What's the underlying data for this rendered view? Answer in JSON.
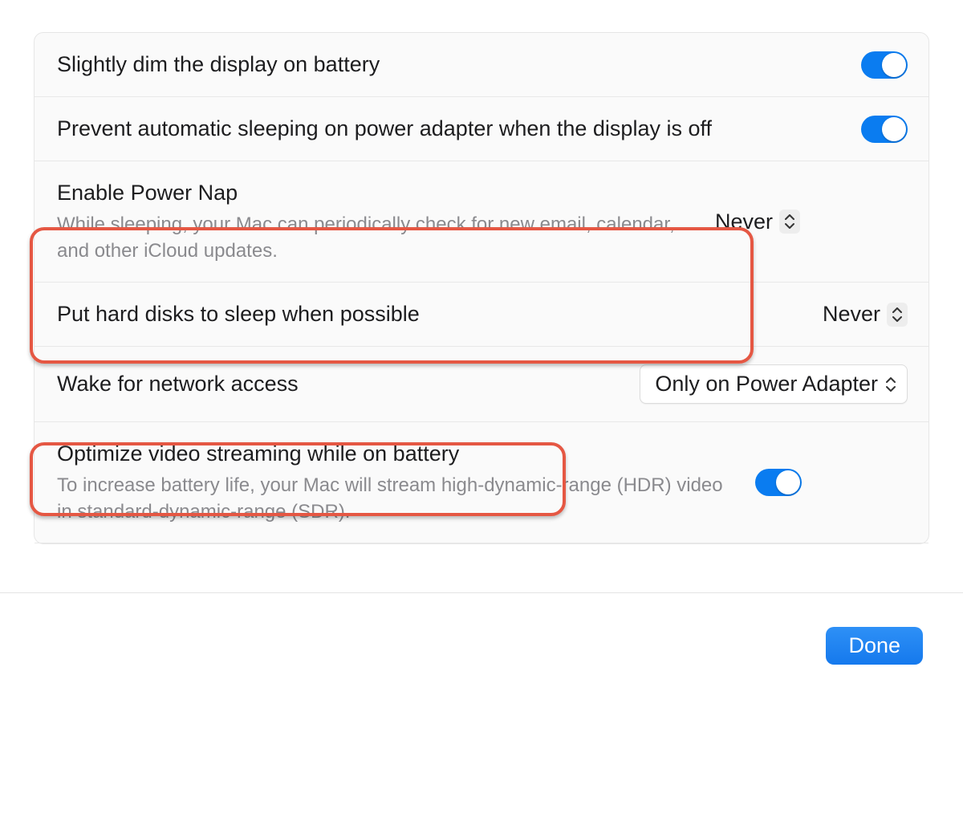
{
  "rows": {
    "dim": {
      "title": "Slightly dim the display on battery"
    },
    "preventSleep": {
      "title": "Prevent automatic sleeping on power adapter when the display is off"
    },
    "powerNap": {
      "title": "Enable Power Nap",
      "desc": "While sleeping, your Mac can periodically check for new email, calendar, and other iCloud updates.",
      "value": "Never"
    },
    "hardDisks": {
      "title": "Put hard disks to sleep when possible",
      "value": "Never"
    },
    "wakeNetwork": {
      "title": "Wake for network access",
      "value": "Only on Power Adapter"
    },
    "optimizeVideo": {
      "title": "Optimize video streaming while on battery",
      "desc": "To increase battery life, your Mac will stream high-dynamic-range (HDR) video in standard-dynamic-range (SDR)."
    }
  },
  "footer": {
    "done": "Done"
  }
}
